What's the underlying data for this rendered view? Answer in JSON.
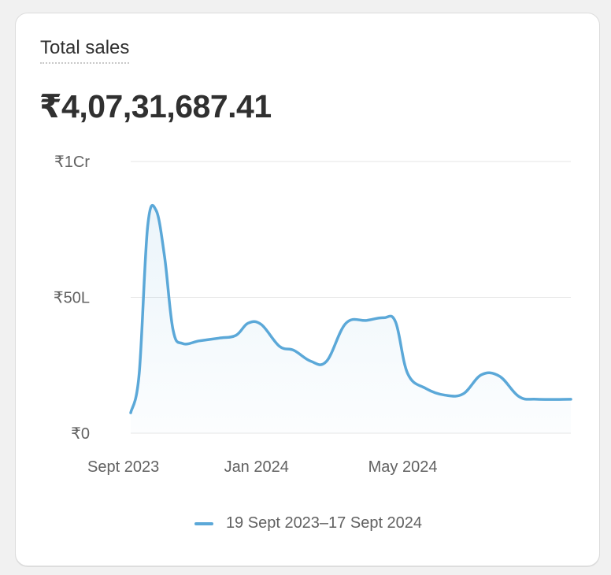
{
  "card": {
    "title": "Total sales",
    "total": "₹4,07,31,687.41"
  },
  "chart_data": {
    "type": "area",
    "title": "Total sales",
    "y_ticks": [
      {
        "value": 0,
        "label": "₹0"
      },
      {
        "value": 5000000,
        "label": "₹50L"
      },
      {
        "value": 10000000,
        "label": "₹1Cr"
      }
    ],
    "ylim": [
      0,
      10000000
    ],
    "x_ticks": [
      {
        "value": "2023-09-19",
        "label": "Sept 2023"
      },
      {
        "value": "2024-01-01",
        "label": "Jan 2024"
      },
      {
        "value": "2024-05-01",
        "label": "May 2024"
      }
    ],
    "xlim": [
      "2023-09-19",
      "2024-09-17"
    ],
    "grid": true,
    "legend": "bottom-center",
    "series": [
      {
        "name": "19 Sept 2023–17 Sept 2024",
        "color": "#5ba8d8",
        "points": [
          {
            "x": "2023-09-19",
            "y": 750000
          },
          {
            "x": "2023-09-26",
            "y": 2200000
          },
          {
            "x": "2023-10-03",
            "y": 7600000
          },
          {
            "x": "2023-10-10",
            "y": 8200000
          },
          {
            "x": "2023-10-17",
            "y": 6500000
          },
          {
            "x": "2023-10-24",
            "y": 3800000
          },
          {
            "x": "2023-11-01",
            "y": 3300000
          },
          {
            "x": "2023-11-15",
            "y": 3400000
          },
          {
            "x": "2023-12-01",
            "y": 3500000
          },
          {
            "x": "2023-12-15",
            "y": 3600000
          },
          {
            "x": "2023-12-25",
            "y": 4050000
          },
          {
            "x": "2024-01-05",
            "y": 4000000
          },
          {
            "x": "2024-01-20",
            "y": 3200000
          },
          {
            "x": "2024-02-01",
            "y": 3050000
          },
          {
            "x": "2024-02-15",
            "y": 2650000
          },
          {
            "x": "2024-02-28",
            "y": 2650000
          },
          {
            "x": "2024-03-15",
            "y": 4050000
          },
          {
            "x": "2024-04-01",
            "y": 4150000
          },
          {
            "x": "2024-04-15",
            "y": 4250000
          },
          {
            "x": "2024-04-25",
            "y": 4100000
          },
          {
            "x": "2024-05-05",
            "y": 2200000
          },
          {
            "x": "2024-05-20",
            "y": 1650000
          },
          {
            "x": "2024-06-05",
            "y": 1400000
          },
          {
            "x": "2024-06-20",
            "y": 1450000
          },
          {
            "x": "2024-07-05",
            "y": 2150000
          },
          {
            "x": "2024-07-20",
            "y": 2100000
          },
          {
            "x": "2024-08-05",
            "y": 1350000
          },
          {
            "x": "2024-08-20",
            "y": 1250000
          },
          {
            "x": "2024-09-17",
            "y": 1250000
          }
        ]
      }
    ]
  }
}
